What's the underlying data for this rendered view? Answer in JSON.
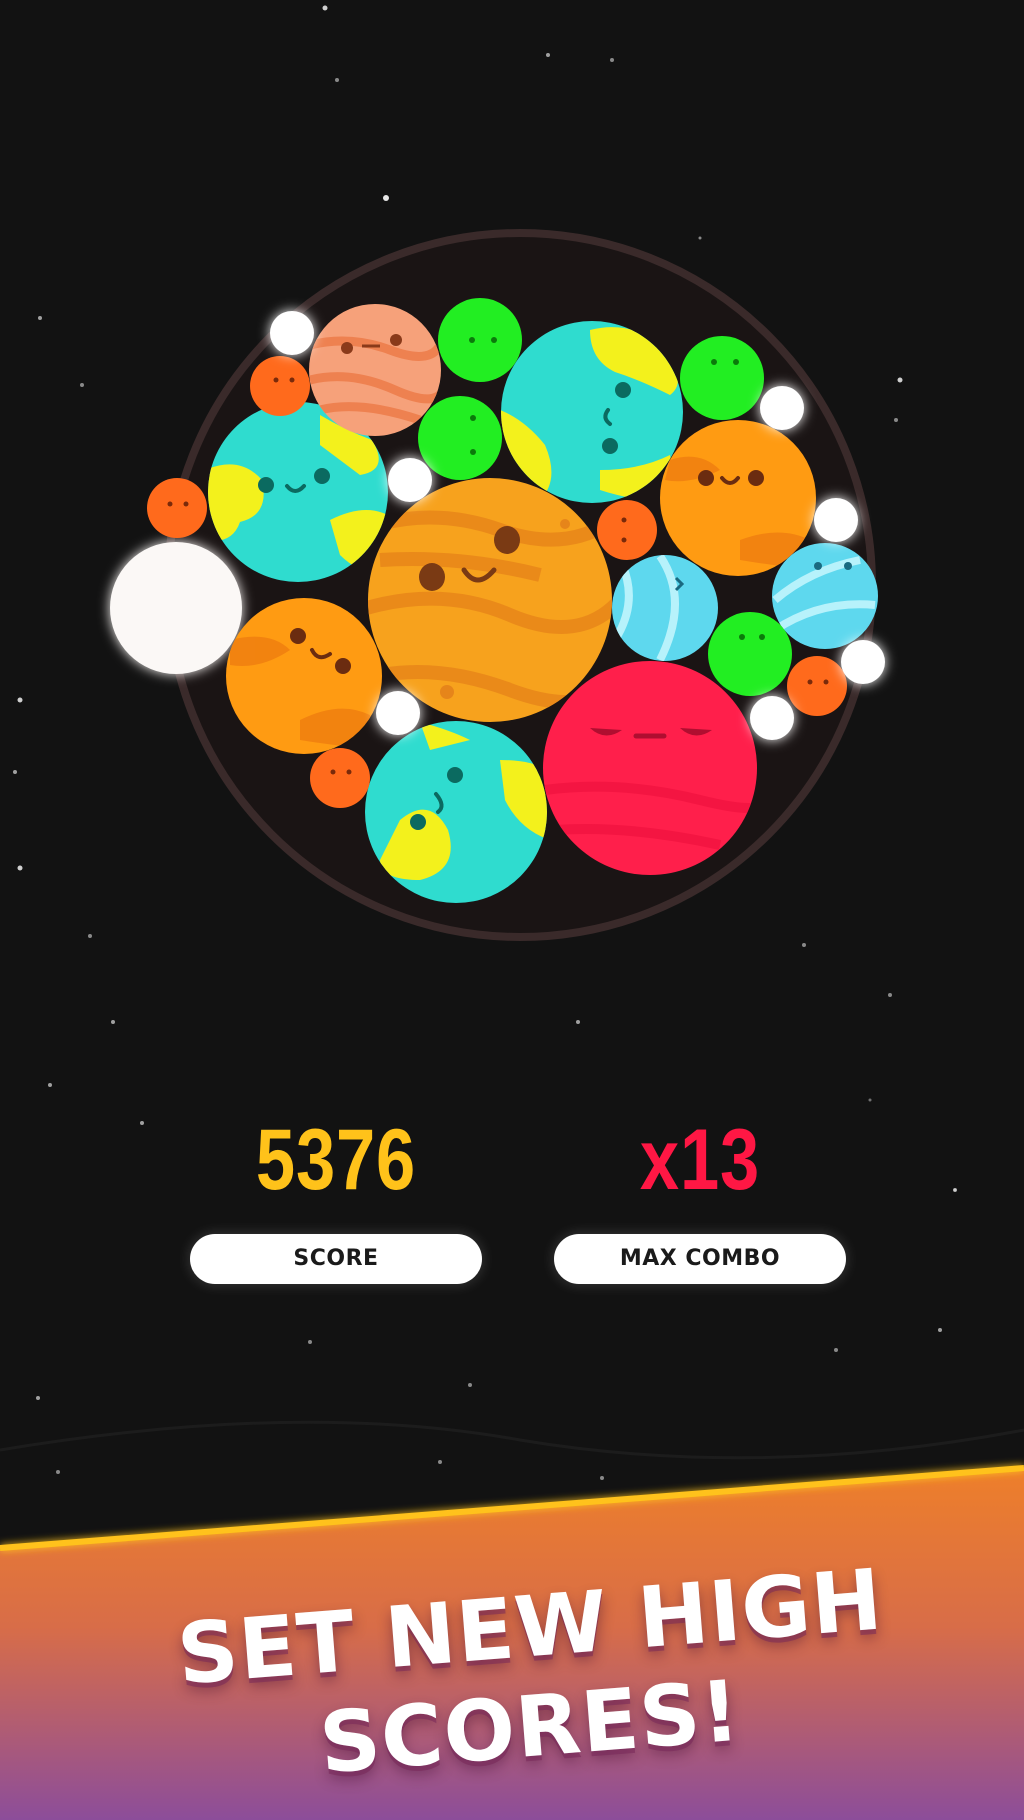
{
  "score": {
    "value": "5376",
    "label": "SCORE",
    "color": "#ffc21a"
  },
  "max_combo": {
    "value": "x13",
    "label": "MAX COMBO",
    "color": "#ff1744"
  },
  "promo": {
    "line1": "SET NEW HIGH",
    "line2": "SCORES!"
  },
  "colors": {
    "background": "#121212",
    "banner_top": "#ee7f2a",
    "banner_bottom": "#8c4d9a",
    "banner_edge": "#ffc21a",
    "container_ring": "#3a2a2a"
  },
  "planets": [
    {
      "kind": "jupiter",
      "color": "#f7a21d",
      "face": "happy"
    },
    {
      "kind": "earth",
      "color": "#2fdccf",
      "face": "happy"
    },
    {
      "kind": "earth",
      "color": "#2fdccf",
      "face": "happy"
    },
    {
      "kind": "earth",
      "color": "#2fdccf",
      "face": "happy"
    },
    {
      "kind": "mars",
      "color": "#ff1f4b",
      "face": "angry"
    },
    {
      "kind": "sun",
      "color": "#ff9b12",
      "face": "cute"
    },
    {
      "kind": "sun",
      "color": "#ff9b12",
      "face": "cute"
    },
    {
      "kind": "venus",
      "color": "#f6a17a",
      "face": "flat"
    },
    {
      "kind": "neptune",
      "color": "#5ed8ee",
      "face": "happy"
    },
    {
      "kind": "neptune",
      "color": "#5ed8ee",
      "face": "happy"
    },
    {
      "kind": "green",
      "color": "#22ee22",
      "face": "small"
    },
    {
      "kind": "green",
      "color": "#22ee22",
      "face": "small"
    },
    {
      "kind": "green",
      "color": "#22ee22",
      "face": "small"
    },
    {
      "kind": "green",
      "color": "#22ee22",
      "face": "small"
    },
    {
      "kind": "moon",
      "color": "#ffffff",
      "face": "none"
    },
    {
      "kind": "small",
      "color": "#ff6a1c",
      "face": "small"
    },
    {
      "kind": "small",
      "color": "#ff6a1c",
      "face": "small"
    },
    {
      "kind": "small",
      "color": "#ff6a1c",
      "face": "small"
    },
    {
      "kind": "small",
      "color": "#ff6a1c",
      "face": "small"
    },
    {
      "kind": "small",
      "color": "#ff6a1c",
      "face": "small"
    },
    {
      "kind": "tiny",
      "color": "#ffffff",
      "face": "tiny"
    },
    {
      "kind": "tiny",
      "color": "#ffffff",
      "face": "tiny"
    },
    {
      "kind": "tiny",
      "color": "#ffffff",
      "face": "tiny"
    },
    {
      "kind": "tiny",
      "color": "#ffffff",
      "face": "tiny"
    },
    {
      "kind": "tiny",
      "color": "#ffffff",
      "face": "tiny"
    },
    {
      "kind": "tiny",
      "color": "#ffffff",
      "face": "tiny"
    },
    {
      "kind": "tiny",
      "color": "#ffffff",
      "face": "tiny"
    }
  ]
}
